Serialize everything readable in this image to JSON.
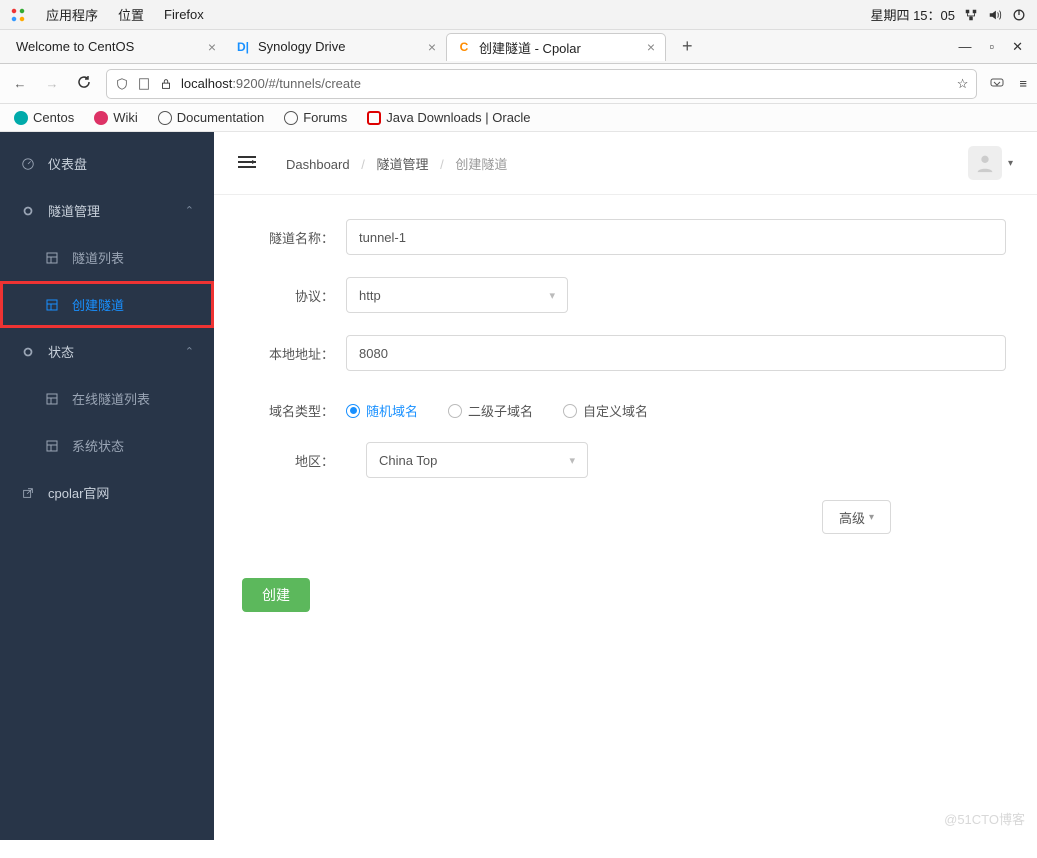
{
  "desktop": {
    "menus": [
      "应用程序",
      "位置",
      "Firefox"
    ],
    "clock": "星期四 15：05"
  },
  "browser": {
    "tabs": [
      {
        "label": "Welcome to CentOS",
        "icon": "",
        "color": ""
      },
      {
        "label": "Synology Drive",
        "icon": "D|",
        "color": "blue"
      },
      {
        "label": "创建隧道 - Cpolar",
        "icon": "C",
        "color": "orange"
      }
    ],
    "url_prefix": "localhost",
    "url_path": ":9200/#/tunnels/create",
    "bookmarks": [
      "Centos",
      "Wiki",
      "Documentation",
      "Forums",
      "Java Downloads | Oracle"
    ]
  },
  "sidebar": {
    "dashboard": "仪表盘",
    "tunnel_mgmt": "隧道管理",
    "tunnel_list": "隧道列表",
    "create_tunnel": "创建隧道",
    "status": "状态",
    "online_list": "在线隧道列表",
    "sys_status": "系统状态",
    "official_site": "cpolar官网"
  },
  "crumbs": {
    "dashboard": "Dashboard",
    "mgmt": "隧道管理",
    "create": "创建隧道"
  },
  "form": {
    "name_label": "隧道名称：",
    "name_value": "tunnel-1",
    "proto_label": "协议：",
    "proto_value": "http",
    "addr_label": "本地地址：",
    "addr_value": "8080",
    "domain_type_label": "域名类型：",
    "domain_opts": [
      "随机域名",
      "二级子域名",
      "自定义域名"
    ],
    "region_label": "地区：",
    "region_value": "China Top",
    "advanced": "高级",
    "submit": "创建"
  },
  "watermark": "@51CTO博客"
}
